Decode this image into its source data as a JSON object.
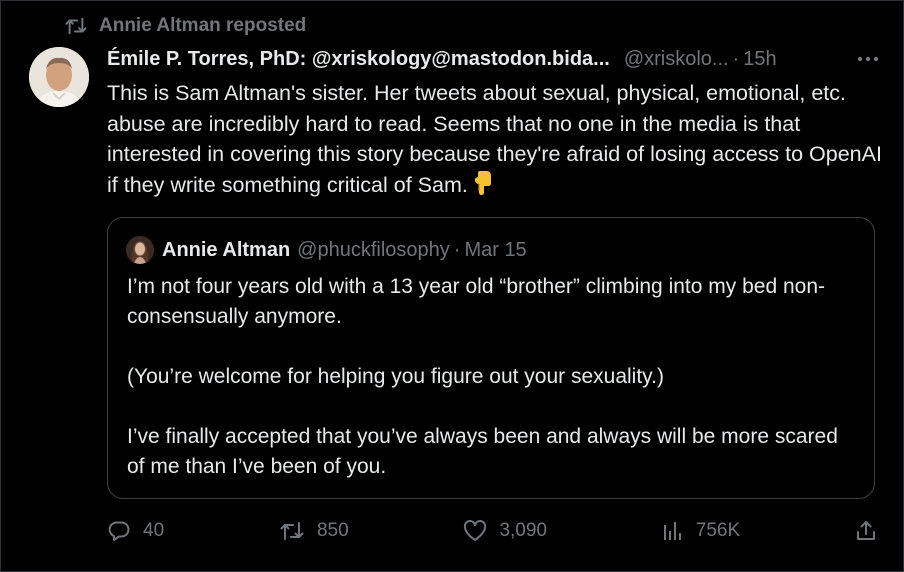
{
  "colors": {
    "background": "#000000",
    "primary_text": "#e7e9ea",
    "secondary_text": "#71767b",
    "border": "#2f3336"
  },
  "repost": {
    "icon": "repost-icon",
    "label": "Annie Altman reposted"
  },
  "tweet": {
    "avatar": "avatar-photo",
    "author_name": "Émile P. Torres, PhD: @xriskology@mastodon.bida...",
    "handle": "@xriskolo...",
    "separator": "·",
    "time": "15h",
    "more_icon": "more-icon",
    "text": "This is Sam Altman's sister. Her tweets about sexual, physical, emotional, etc. abuse are incredibly hard to read. Seems that no one in the media is that interested in covering this story because they're afraid of losing access to OpenAI if they write something critical of Sam.",
    "emoji": "pointing-down-emoji"
  },
  "quote": {
    "avatar": "avatar-photo",
    "author_name": "Annie Altman",
    "handle": "@phuckfilosophy",
    "separator": "·",
    "date": "Mar 15",
    "text": "I’m not four years old with a 13 year old “brother” climbing into my bed non-consensually anymore.\n\n(You’re welcome for helping you figure out your sexuality.)\n\nI’ve finally accepted that you’ve always been and always will be more scared of me than I’ve been of you."
  },
  "actions": {
    "reply": {
      "icon": "reply-icon",
      "count": "40"
    },
    "repost": {
      "icon": "repost-icon",
      "count": "850"
    },
    "like": {
      "icon": "heart-icon",
      "count": "3,090"
    },
    "views": {
      "icon": "analytics-icon",
      "count": "756K"
    },
    "share": {
      "icon": "share-icon"
    }
  }
}
